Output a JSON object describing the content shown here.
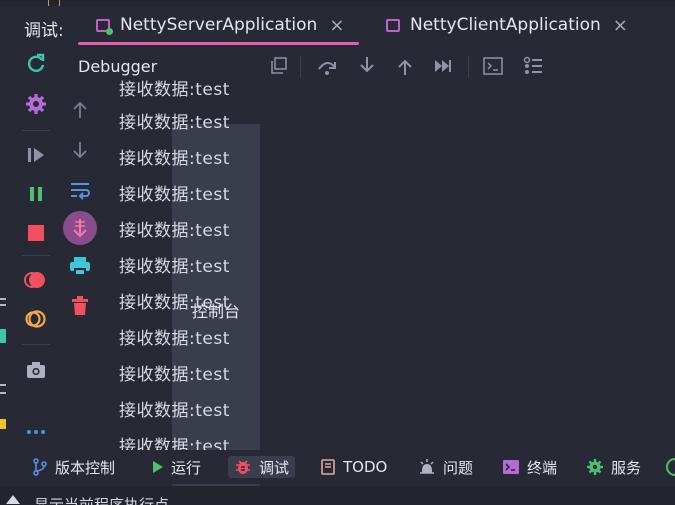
{
  "header": {
    "debug_label": "调试:",
    "tabs": [
      {
        "label": "NettyServerApplication",
        "active": true
      },
      {
        "label": "NettyClientApplication",
        "active": false
      }
    ],
    "close_glyph": "×"
  },
  "toolbar": {
    "debugger_label": "Debugger",
    "console_label": "控制台"
  },
  "console": {
    "lines": [
      "接收数据:test",
      "接收数据:test",
      "接收数据:test",
      "接收数据:test",
      "接收数据:test",
      "接收数据:test",
      "接收数据:test",
      "接收数据:test",
      "接收数据:test",
      "接收数据:test",
      "接收数据:test"
    ]
  },
  "bottom_tools": [
    {
      "label": "版本控制",
      "icon": "branch-icon"
    },
    {
      "label": "运行",
      "icon": "play-icon"
    },
    {
      "label": "调试",
      "icon": "bug-icon",
      "active": true
    },
    {
      "label": "TODO",
      "icon": "todo-icon"
    },
    {
      "label": "问题",
      "icon": "problems-icon"
    },
    {
      "label": "终端",
      "icon": "terminal-icon"
    },
    {
      "label": "服务",
      "icon": "services-icon"
    }
  ],
  "status": {
    "text": "显示当前程序执行点"
  },
  "colors": {
    "accent": "#e05fb0",
    "background": "#272a35",
    "green": "#4ac26b",
    "red": "#f0505f",
    "cyan": "#3cc6d8"
  }
}
